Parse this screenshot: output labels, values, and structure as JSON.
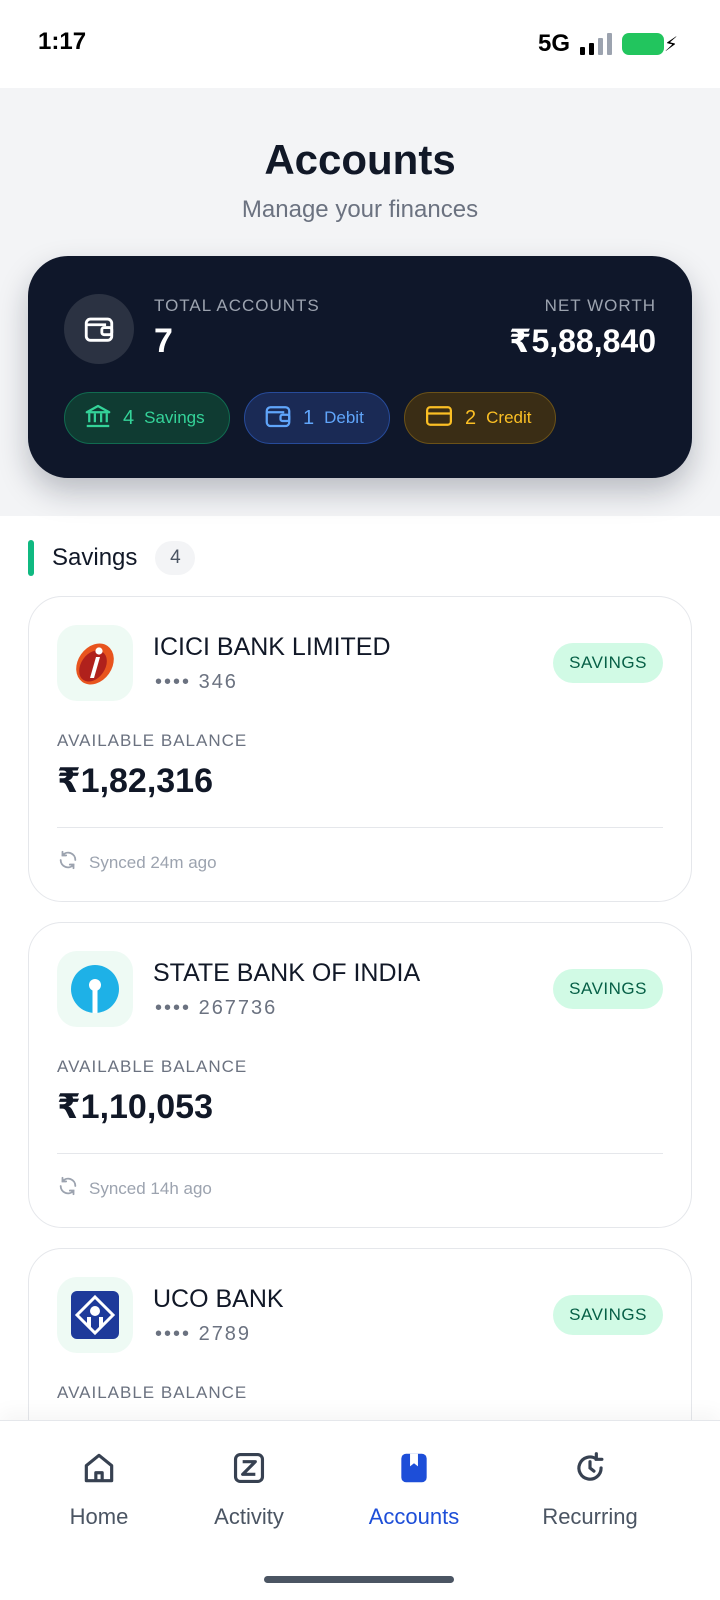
{
  "status_bar": {
    "time": "1:17",
    "network": "5G"
  },
  "header": {
    "title": "Accounts",
    "subtitle": "Manage your finances"
  },
  "summary": {
    "total_label": "TOTAL ACCOUNTS",
    "total_value": "7",
    "net_worth_label": "NET WORTH",
    "net_worth_value": "₹5,88,840",
    "chips": [
      {
        "count": "4",
        "label": "Savings",
        "icon": "bank-icon",
        "color": "#34d399"
      },
      {
        "count": "1",
        "label": "Debit",
        "icon": "wallet-icon",
        "color": "#60a5fa"
      },
      {
        "count": "2",
        "label": "Credit",
        "icon": "credit-card-icon",
        "color": "#fbbf24"
      }
    ]
  },
  "section": {
    "title": "Savings",
    "count": "4"
  },
  "accounts": [
    {
      "bank": "ICICI BANK LIMITED",
      "mask": "•••• 346",
      "type": "SAVINGS",
      "balance_label": "AVAILABLE BALANCE",
      "balance": "₹1,82,316",
      "sync": "Synced 24m ago",
      "logo": "icici-logo"
    },
    {
      "bank": "STATE BANK OF INDIA",
      "mask": "•••• 267736",
      "type": "SAVINGS",
      "balance_label": "AVAILABLE BALANCE",
      "balance": "₹1,10,053",
      "sync": "Synced 14h ago",
      "logo": "sbi-logo"
    },
    {
      "bank": "UCO BANK",
      "mask": "•••• 2789",
      "type": "SAVINGS",
      "balance_label": "AVAILABLE BALANCE",
      "logo": "uco-logo"
    }
  ],
  "nav": [
    {
      "label": "Home",
      "icon": "home-icon"
    },
    {
      "label": "Activity",
      "icon": "activity-icon"
    },
    {
      "label": "Accounts",
      "icon": "accounts-icon",
      "active": true
    },
    {
      "label": "Recurring",
      "icon": "recurring-icon"
    }
  ],
  "colors": {
    "accent": "#1d4ed8",
    "savings_green": "#10b981",
    "card_dark": "#0f172a"
  }
}
